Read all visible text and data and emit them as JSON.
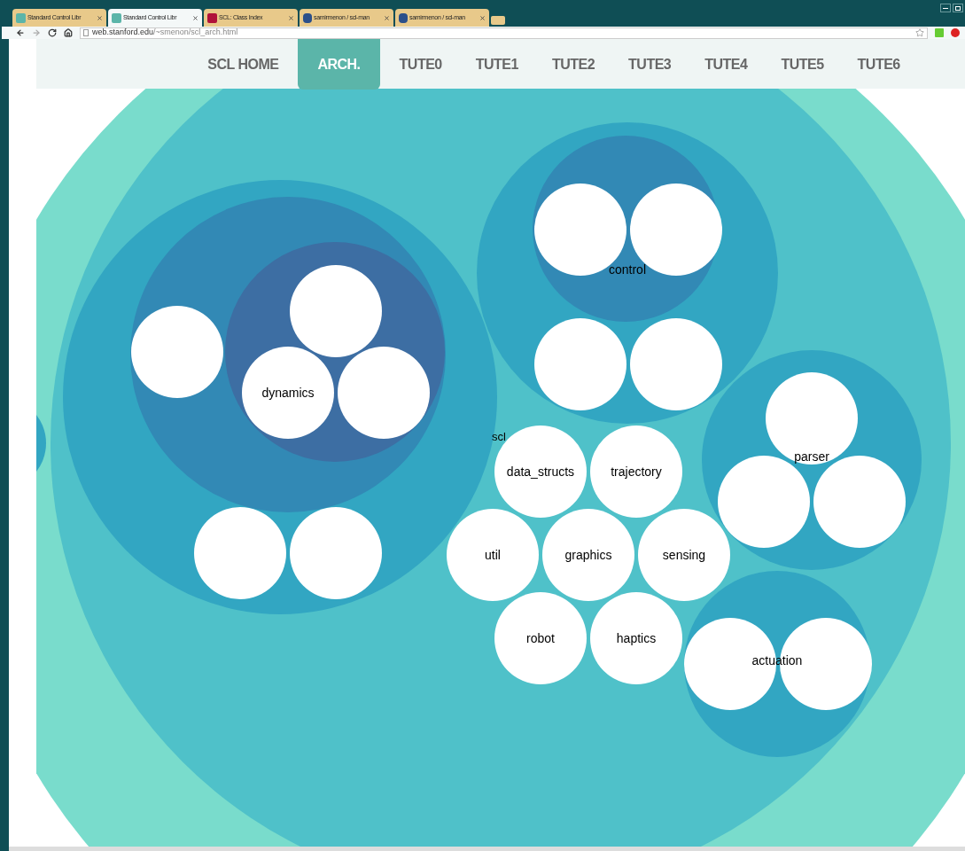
{
  "browser": {
    "tabs": [
      {
        "title": "Standard Control Libr",
        "kind": "site",
        "selected": false
      },
      {
        "title": "Standard Control Libr",
        "kind": "site",
        "selected": true
      },
      {
        "title": "SCL: Class Index",
        "kind": "scl",
        "selected": false
      },
      {
        "title": "samirmenon / scl-man",
        "kind": "github",
        "selected": false
      },
      {
        "title": "samirmenon / scl-man",
        "kind": "github",
        "selected": false
      }
    ],
    "url_host": "web.stanford.edu",
    "url_path": "/~smenon/scl_arch.html"
  },
  "nav": [
    {
      "label": "SCL HOME",
      "selected": false
    },
    {
      "label": "ARCH.",
      "selected": true
    },
    {
      "label": "TUTE0",
      "selected": false
    },
    {
      "label": "TUTE1",
      "selected": false
    },
    {
      "label": "TUTE2",
      "selected": false
    },
    {
      "label": "TUTE3",
      "selected": false
    },
    {
      "label": "TUTE4",
      "selected": false
    },
    {
      "label": "TUTE5",
      "selected": false
    },
    {
      "label": "TUTE6",
      "selected": false
    }
  ],
  "diagram": {
    "root_label": "scl",
    "groups": [
      "dynamics",
      "control",
      "parser",
      "actuation"
    ],
    "leaves": [
      "data_structs",
      "trajectory",
      "util",
      "graphics",
      "sensing",
      "robot",
      "haptics"
    ]
  }
}
